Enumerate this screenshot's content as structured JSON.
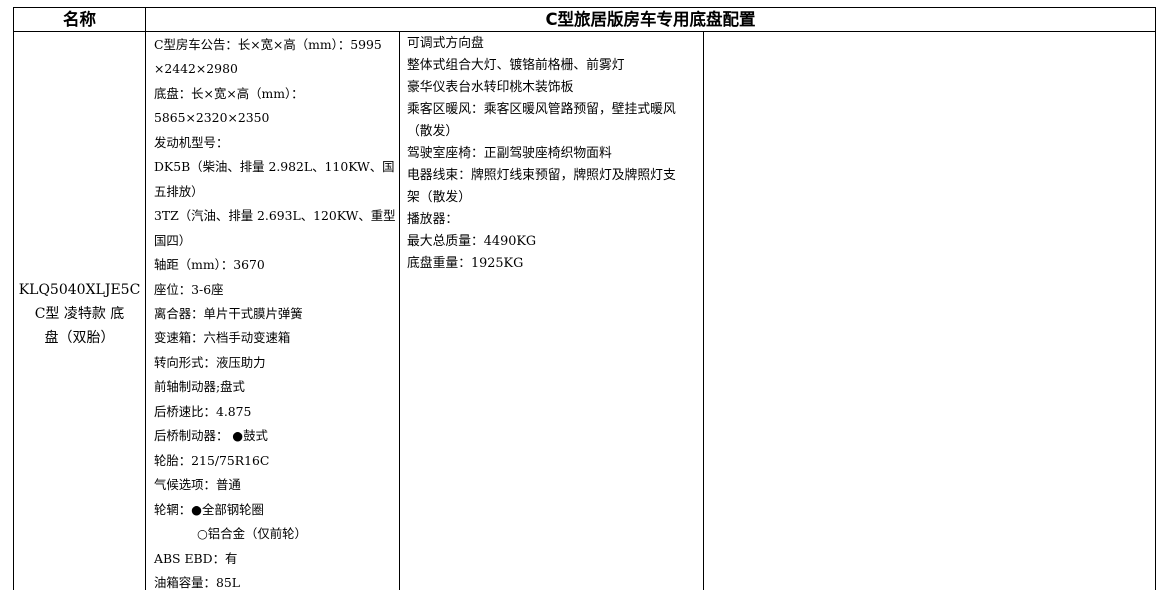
{
  "header": {
    "name_label": "名称",
    "config_title": "C型旅居版房车专用底盘配置"
  },
  "model": {
    "lines": [
      "KLQ5040XLJE5C",
      "C型 凌特款 底",
      "盘（双胎）"
    ]
  },
  "specs": {
    "lines": [
      "C型房车公告：长×宽×高（mm）：5995",
      "×2442×2980",
      "底盘：长×宽×高（mm）：",
      "5865×2320×2350",
      "发动机型号：",
      "DK5B（柴油、排量 2.982L、110KW、国",
      "五排放）",
      "3TZ（汽油、排量 2.693L、120KW、重型",
      "国四）",
      "轴距（mm）：3670",
      "座位：3-6座",
      "离合器：单片干式膜片弹簧",
      "变速箱：六档手动变速箱",
      "转向形式：液压助力",
      "前轴制动器;盘式",
      "后桥速比：4.875",
      "后桥制动器：  ●鼓式",
      "轮胎：215/75R16C",
      "气候选项：普通",
      "轮辋：●全部钢轮圈",
      "○铝合金（仅前轮）",
      "ABS EBD：有",
      "油箱容量：85L"
    ]
  },
  "features": {
    "lines": [
      "可调式方向盘",
      "整体式组合大灯、镀铬前格栅、前雾灯",
      "豪华仪表台水转印桃木装饰板",
      "乘客区暖风：乘客区暖风管路预留，壁挂式暖风",
      "（散发）",
      "驾驶室座椅：正副驾驶座椅织物面料",
      "电器线束：牌照灯线束预留，牌照灯及牌照灯支",
      "架（散发）",
      "播放器：",
      "最大总质量：4490KG",
      "底盘重量：1925KG"
    ]
  }
}
